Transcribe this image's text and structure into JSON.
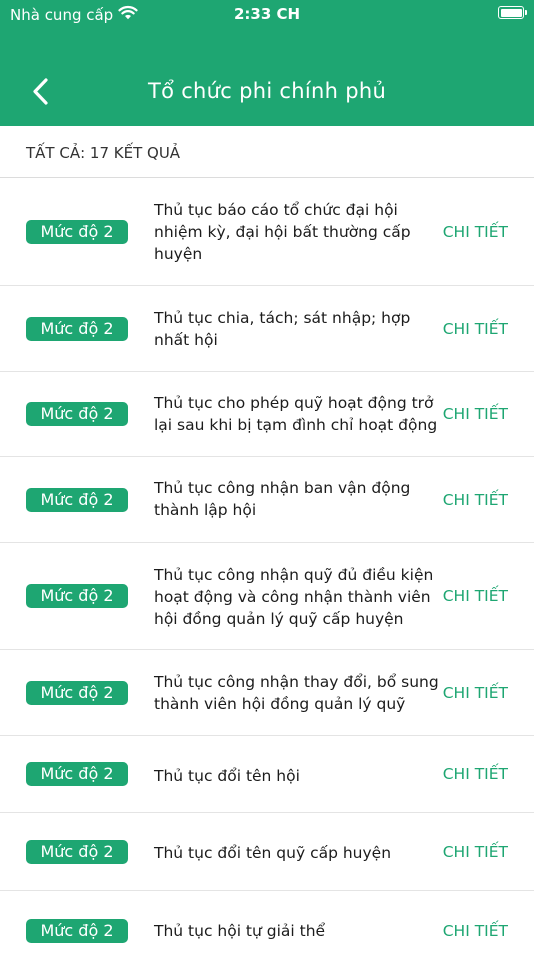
{
  "status_bar": {
    "carrier": "Nhà cung cấp",
    "time": "2:33 CH",
    "wifi_icon": "wifi-icon",
    "battery_icon": "battery-icon"
  },
  "nav": {
    "back_icon": "chevron-left-icon",
    "title": "Tổ chức phi chính phủ"
  },
  "result_summary": "TẤT CẢ: 17 KẾT QUẢ",
  "colors": {
    "accent": "#1ea672"
  },
  "items": [
    {
      "badge": "Mức độ 2",
      "title": "Thủ tục báo cáo tổ chức đại hội nhiệm kỳ, đại hội bất thường cấp huyện",
      "action": "CHI TIẾT"
    },
    {
      "badge": "Mức độ 2",
      "title": "Thủ tục chia, tách; sát nhập; hợp nhất hội",
      "action": "CHI TIẾT"
    },
    {
      "badge": "Mức độ 2",
      "title": "Thủ tục cho phép quỹ hoạt động trở lại sau khi bị tạm đình chỉ hoạt động",
      "action": "CHI TIẾT"
    },
    {
      "badge": "Mức độ 2",
      "title": "Thủ tục công nhận ban vận động thành lập hội",
      "action": "CHI TIẾT"
    },
    {
      "badge": "Mức độ 2",
      "title": "Thủ tục công nhận quỹ đủ điều kiện hoạt động và công nhận thành viên hội đồng quản lý quỹ cấp huyện",
      "action": "CHI TIẾT"
    },
    {
      "badge": "Mức độ 2",
      "title": "Thủ tục công nhận thay đổi, bổ sung thành viên hội đồng quản lý quỹ",
      "action": "CHI TIẾT"
    },
    {
      "badge": "Mức độ 2",
      "title": "Thủ tục đổi tên hội",
      "action": "CHI TIẾT"
    },
    {
      "badge": "Mức độ 2",
      "title": "Thủ tục đổi tên quỹ cấp huyện",
      "action": "CHI TIẾT"
    },
    {
      "badge": "Mức độ 2",
      "title": "Thủ tục hội tự giải thể",
      "action": "CHI TIẾT"
    }
  ]
}
